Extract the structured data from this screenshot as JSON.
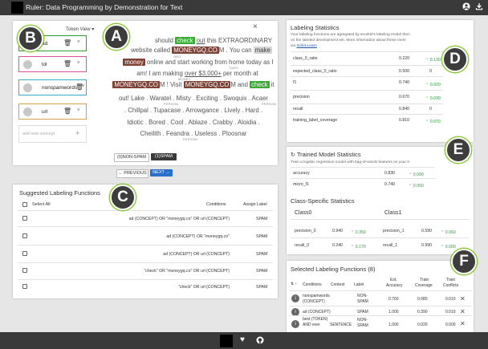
{
  "app": {
    "title": "Ruler: Data Programming by Demonstration for Text",
    "user_icon": "user-icon",
    "download_icon": "download-icon"
  },
  "concepts": {
    "view_label": "Token View",
    "items": [
      {
        "name": "ad",
        "color": "#2e9e2e"
      },
      {
        "name": "lol",
        "color": "#d9509f"
      },
      {
        "name": "nonspamwords",
        "color": "#33aacc"
      },
      {
        "name": "url",
        "color": "#d2a24a"
      }
    ],
    "add_placeholder": "add new concept",
    "add_symbol": "+"
  },
  "document": {
    "close": "×",
    "l1a": "should ",
    "l1b": "check",
    " l1c": "",
    "l1d": " out this EXTRAORDINARY",
    "l1": [
      " should ",
      "check",
      " ",
      "out",
      " this EXTRAORDINARY"
    ],
    "l2a": "website called ",
    "l2b": "MONEYGQ.CO",
    "l2c": "M . You can ",
    "l2d": "make",
    "l2ann": "ORG",
    "l3a": "money",
    " l3b": "",
    "l3rest": " online and start working from home today as I",
    "l3ann": "DATE",
    "l4a": "am! I am making ",
    "l4b": "over $3,000+",
    " l4c": "",
    "l4rest": " per month at",
    "l4ann": "MONEY",
    "l5a": "MONEYGQ.CO",
    "l5b": "M ! Visit ",
    "l5c": "MONEYGQ.CO",
    "l5d": "M and ",
    "l5e": "check",
    " l5f": "",
    "l5rest": " it",
    "l6": "out! Lake . Waratel . Misty . Exciting . Swoquix . Acaer",
    "l6ann1": "PERSON",
    "l6ann2": "PERSON",
    "l7": ". Chillpal . Tupacase . Arrowgance . Lively . Hard .",
    "l8": "Idiotic . Bored . Cool . Ablaze . Crabby . Aloidia .",
    "l9": "Cheilith . Feandra . Useless . Ploosnar",
    "l9ann": "PERSON",
    "label_0": "(0)NON-SPAM",
    "label_1": "(1)SPAM",
    "prev": "← PREVIOUS",
    "next": "NEXT →"
  },
  "suggested": {
    "title": "Suggested Labeling Functions",
    "select_all": "Select All",
    "col_conditions": "Conditions",
    "col_assign": "Assign Label",
    "rows": [
      {
        "cond": "ad (CONCEPT) OR \"moneygq.co\" OR url (CONCEPT)",
        "label": "SPAM"
      },
      {
        "cond": "ad (CONCEPT) OR \"moneygq.co\"",
        "label": "SPAM"
      },
      {
        "cond": "ad (CONCEPT) OR url (CONCEPT)",
        "label": "SPAM"
      },
      {
        "cond": "\"check\" OR \"moneygq.co\" OR url (CONCEPT)",
        "label": "SPAM"
      },
      {
        "cond": "\"check\" OR url (CONCEPT)",
        "label": "SPAM"
      }
    ]
  },
  "labeling_stats": {
    "title": "Labeling Statistics",
    "desc1": "Your labeling functions are agregated by snorkel's labeling model then",
    "desc2": "on the labeled development set. More information about these metri",
    "desc3": "via ",
    "link": "Scikit-Learn",
    "rows": [
      {
        "name": "class_0_ratio",
        "val": "0.220",
        "delta": "0.130"
      },
      {
        "name": "expected_class_0_ratio",
        "val": "0.500",
        "delta": "0"
      },
      {
        "name": "f1",
        "val": "0.740",
        "delta": "0.020"
      },
      {
        "name": "precision",
        "val": "0.670",
        "delta": "0.030"
      },
      {
        "name": "recall",
        "val": "0.840",
        "delta": "0"
      },
      {
        "name": "training_label_coverage",
        "val": "0.810",
        "delta": "0.070"
      }
    ]
  },
  "trained": {
    "title": "Trained Model Statistics",
    "desc": "Train a logistic regression model with bag-of-words features on your tr",
    "rows": [
      {
        "name": "accuracy",
        "val": "0.830",
        "delta": "0.090"
      },
      {
        "name": "micro_f1",
        "val": "0.740",
        "delta": "0.050"
      }
    ]
  },
  "class_stats": {
    "title": "Class-Specific Statistics",
    "class0": "Class0",
    "class1": "Class1",
    "rows": [
      {
        "n0": "precision_0",
        "v0": "0.940",
        "d0": "0.350",
        "n1": "precision_1",
        "v1": "0.590",
        "d1": "0.060"
      },
      {
        "n0": "recall_0",
        "v0": "0.240",
        "d0": "0.170",
        "n1": "recall_1",
        "v1": "0.990",
        "d1": "0.000"
      }
    ]
  },
  "selected": {
    "title": "Selected Labeling Functions (8)",
    "h_sort": "↑",
    "h_conditions": "Conditions",
    "h_context": "Context",
    "h_label": "Label",
    "h_acc1": "Est.",
    "h_acc2": "Accuracy",
    "h_cov1": "Train",
    "h_cov2": "Coverage",
    "h_conf1": "Train",
    "h_conf2": "Conflicts",
    "rows": [
      {
        "c1": "nonspamwords",
        "c2": "(CONCEPT)",
        "ctx": "",
        "l1": "NON-",
        "l2": "SPAM",
        "acc": "0.760",
        "cov": "0.080",
        "conf": "0.010"
      },
      {
        "c1": "ad (CONCEPT)",
        "c2": "",
        "ctx": "",
        "l1": "SPAM",
        "l2": "",
        "acc": "1.000",
        "cov": "0.390",
        "conf": "0.010"
      },
      {
        "c1": "best (TOKEN)",
        "c2": "AND ever",
        "ctx": "SENTENCE",
        "l1": "NON-",
        "l2": "SPAM",
        "acc": "1.000",
        "cov": "0.020",
        "conf": "0.000"
      }
    ]
  },
  "callouts": {
    "a": "A",
    "b": "B",
    "c": "C",
    "d": "D",
    "e": "E",
    "f": "F"
  },
  "footer": {
    "heart": "♥",
    "github_icon": "github-icon"
  }
}
